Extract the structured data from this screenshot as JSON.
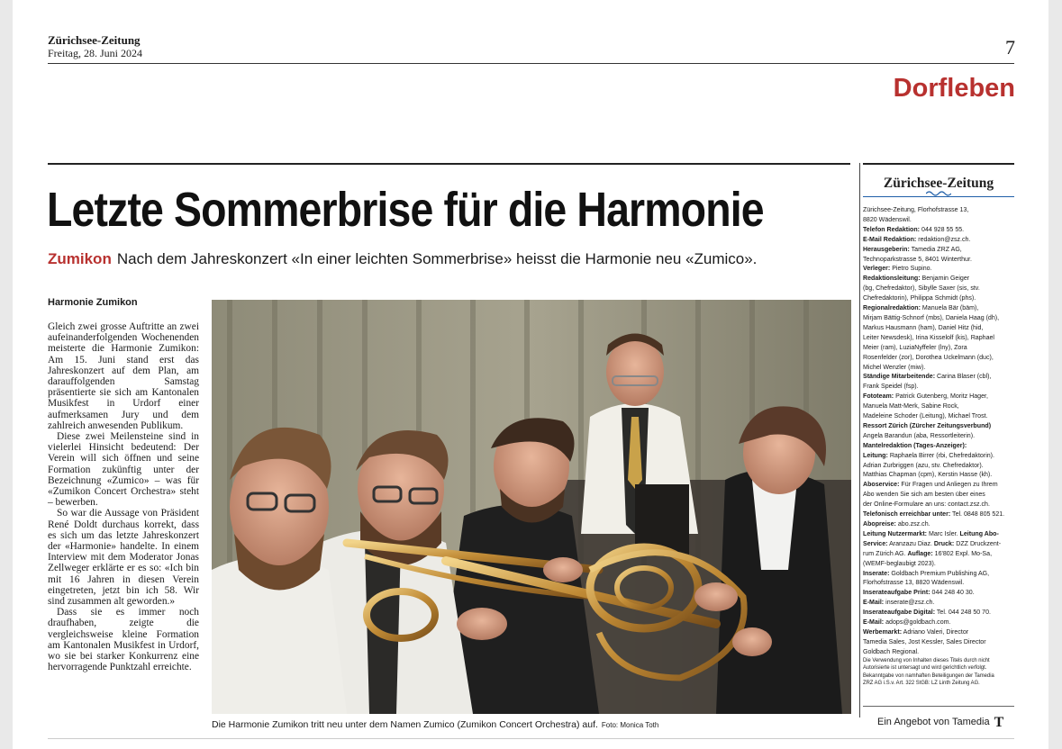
{
  "masthead": {
    "name": "Zürichsee-Zeitung",
    "date": "Freitag, 28. Juni 2024",
    "page_number": "7",
    "section": "Dorfleben"
  },
  "article": {
    "headline": "Letzte Sommerbrise für die Harmonie",
    "kicker": "Zumikon",
    "lead": "Nach dem Jahreskonzert «In einer leichten Sommerbrise» heisst die Harmonie neu «Zumico».",
    "author": "Harmonie Zumikon",
    "paragraphs": [
      "Gleich zwei grosse Auftritte an zwei aufeinanderfolgenden Wochenenden meisterte die Harmonie Zumikon: Am 15. Juni stand erst das Jahreskonzert auf dem Plan, am darauffolgenden Samstag präsentierte sie sich am Kantonalen Musikfest in Urdorf einer aufmerksamen Jury und dem zahlreich anwesenden Publikum.",
      "Diese zwei Meilensteine sind in vielerlei Hinsicht bedeutend: Der Verein will sich öffnen und seine Formation zukünftig unter der Bezeichnung «Zumico» – was für «Zumikon Concert Orchestra» steht – bewerben.",
      "So war die Aussage von Präsident René Doldt durchaus korrekt, dass es sich um das letzte Jahreskonzert der «Harmonie» handelte. In einem Interview mit dem Moderator Jonas Zellweger erklärte er es so: «Ich bin mit 16 Jahren in diesen Verein eingetreten, jetzt bin ich 58. Wir sind zusammen alt geworden.»",
      "Dass sie es immer noch draufhaben, zeigte die vergleichsweise kleine Formation am Kantonalen Musikfest in Urdorf, wo sie bei starker Konkurrenz eine hervorragende Punktzahl erreichte."
    ],
    "caption": "Die Harmonie Zumikon tritt neu unter dem Namen Zumico (Zumikon Concert Orchestra) auf.",
    "photo_credit": "Foto: Monica Toth"
  },
  "imprint": {
    "logo": "Zürichsee-Zeitung",
    "lines": [
      {
        "label": "",
        "text": "Zürichsee-Zeitung, Florhofstrasse 13,"
      },
      {
        "label": "",
        "text": "8820 Wädenswil."
      },
      {
        "label": "Telefon Redaktion:",
        "text": " 044 928 55 55."
      },
      {
        "label": "E-Mail Redaktion:",
        "text": " redaktion@zsz.ch."
      },
      {
        "label": "Herausgeberin:",
        "text": " Tamedia ZRZ AG,"
      },
      {
        "label": "",
        "text": "Technoparkstrasse 5, 8401 Winterthur."
      },
      {
        "label": "Verleger:",
        "text": " Pietro Supino."
      },
      {
        "label": "Redaktionsleitung:",
        "text": " Benjamin Geiger"
      },
      {
        "label": "",
        "text": "(bg, Chefredaktor), Sibylle Saxer (sis, stv."
      },
      {
        "label": "",
        "text": "Chefredaktorin), Philippa Schmidt (phs)."
      },
      {
        "label": "Regionalredaktion:",
        "text": " Manuela Bär (bäm),"
      },
      {
        "label": "",
        "text": "Mirjam Bättig-Schnorf (mbs), Daniela Haag (dh),"
      },
      {
        "label": "",
        "text": "Markus Hausmann (ham), Daniel Hitz (hid,"
      },
      {
        "label": "",
        "text": "Leiter Newsdesk), Irina Kisselolf (kis), Raphael"
      },
      {
        "label": "",
        "text": "Meier (ram), LuziaNyffeler (lny), Zora"
      },
      {
        "label": "",
        "text": "Rosenfelder (zor), Dorothea Uckelmann (duc),"
      },
      {
        "label": "",
        "text": "Michel Wenzler (miw)."
      },
      {
        "label": "Ständige Mitarbeitende:",
        "text": " Carina Blaser (cbl),"
      },
      {
        "label": "",
        "text": "Frank Speidel (fsp)."
      },
      {
        "label": "Fototeam:",
        "text": " Patrick Gutenberg, Moritz Hager,"
      },
      {
        "label": "",
        "text": "Manuela Matt-Merk, Sabine Rock,"
      },
      {
        "label": "",
        "text": "Madeleine Schoder (Leitung), Michael Trost."
      },
      {
        "label": "Ressort Zürich (Zürcher Zeitungsverbund)",
        "text": ""
      },
      {
        "label": "",
        "text": "Angela Barandun (aba, Ressortleiterin)."
      },
      {
        "label": "Mantelredaktion (Tages-Anzeiger):",
        "text": ""
      },
      {
        "label": "Leitung:",
        "text": " Raphaela Birrer (rbi, Chefredaktorin)."
      },
      {
        "label": "",
        "text": "Adrian Zurbriggen (azu, stv. Chefredaktor)."
      },
      {
        "label": "",
        "text": "Matthias Chapman (cpm), Kerstin Hasse (kh)."
      },
      {
        "label": "Aboservice:",
        "text": " Für Fragen und Anliegen zu Ihrem"
      },
      {
        "label": "",
        "text": "Abo wenden Sie sich am besten über eines"
      },
      {
        "label": "",
        "text": "der Online-Formulare an uns: contact.zsz.ch."
      },
      {
        "label": "Telefonisch erreichbar unter:",
        "text": " Tel. 0848 805 521."
      },
      {
        "label": "Abopreise:",
        "text": " abo.zsz.ch."
      },
      {
        "label": "Leitung Nutzermarkt:",
        "text": " Marc Isler. "
      },
      {
        "label": "Service:",
        "text": " Aranzazu Diaz. "
      },
      {
        "label": "",
        "text": "rum Zürich AG. "
      },
      {
        "label": "",
        "text": "(WEMF-beglaubigt 2023)."
      },
      {
        "label": "Inserate:",
        "text": " Goldbach Premium Publishing AG,"
      },
      {
        "label": "",
        "text": "Florhofstrasse 13, 8820 Wädenswil."
      },
      {
        "label": "Inserateaufgabe Print:",
        "text": " 044 248 40 30."
      },
      {
        "label": "E-Mail:",
        "text": " inserate@zsz.ch."
      },
      {
        "label": "Inserateaufgabe Digital:",
        "text": " Tel. 044 248 50 70."
      },
      {
        "label": "E-Mail:",
        "text": " adops@goldbach.com."
      },
      {
        "label": "Werbemarkt:",
        "text": " Adriano Valeri, Director"
      },
      {
        "label": "",
        "text": "Tamedia Sales, Jost Kessler, Sales Director"
      },
      {
        "label": "",
        "text": "Goldbach Regional."
      }
    ],
    "extra": {
      "leitung_abo": "Leitung Abo-",
      "druck_label": "Druck:",
      "druck_text": " DZZ Druckzent-",
      "auflage_label": "Auflage:",
      "auflage_text": " 16'802 Expl. Mo-Sa,"
    },
    "disclaimer": [
      "Die Verwendung von Inhalten dieses Titels durch nicht",
      "Autorisierte ist untersagt und wird gerichtlich verfolgt.",
      "Bekanntgabe von namhaften Beteiligungen der Tamedia",
      "ZRZ AG i.S.v. Art. 322 StGB: LZ Linth Zeitung AG."
    ],
    "footer": "Ein Angebot von Tamedia",
    "footer_logo": "T"
  }
}
